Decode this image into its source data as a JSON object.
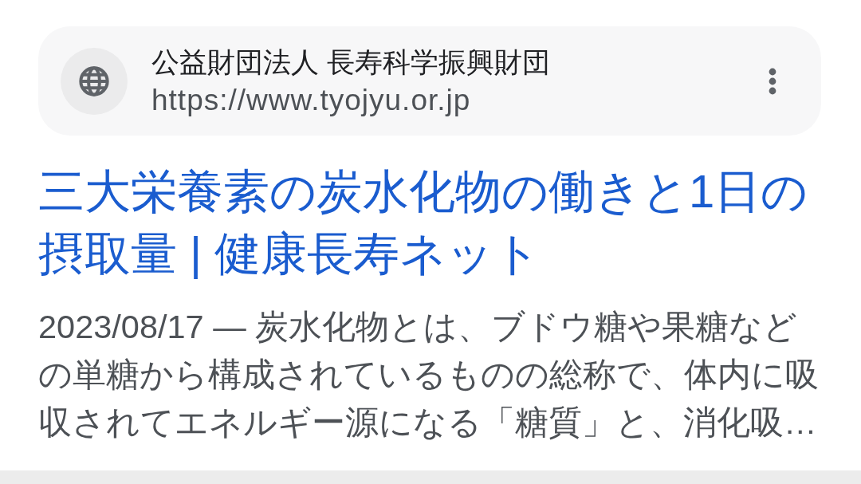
{
  "result": {
    "site_name": "公益財団法人 長寿科学振興財団",
    "url": "https://www.tyojyu.or.jp",
    "title": "三大栄養素の炭水化物の働きと1日の摂取量 | 健康長寿ネット",
    "snippet": "2023/08/17 ― 炭水化物とは、ブドウ糖や果糖などの単糖から構成されているものの総称で、体内に吸収されてエネルギー源になる「糖質」と、消化吸…"
  }
}
